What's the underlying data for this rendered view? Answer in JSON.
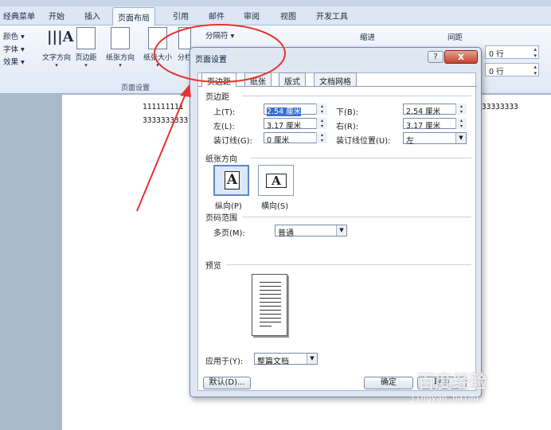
{
  "menu_tabs": [
    "经典菜单",
    "开始",
    "插入",
    "页面布局",
    "引用",
    "邮件",
    "审阅",
    "视图",
    "开发工具"
  ],
  "ribbon": {
    "theme_items": [
      "颜色 ▾",
      "字体 ▾",
      "效果 ▾"
    ],
    "buttons": [
      "文字方向",
      "页边距",
      "纸张方向",
      "纸张大小",
      "分栏"
    ],
    "break_label": "分隔符 ▾",
    "page_setup_group": "页面设置",
    "indent_label": "缩进",
    "spacing_label": "间距",
    "spacing_before": "0 行",
    "spacing_after": "0 行"
  },
  "document": {
    "line1": "111111111",
    "line2": "3333333333",
    "line3": "33333333"
  },
  "dialog": {
    "title": "页面设置",
    "help": "?",
    "close": "x",
    "tabs": [
      "页边距",
      "纸张",
      "版式",
      "文档网格"
    ],
    "margins_section": "页边距",
    "top_label": "上(T):",
    "top_value": "2.54 厘米",
    "bottom_label": "下(B):",
    "bottom_value": "2.54 厘米",
    "left_label": "左(L):",
    "left_value": "3.17 厘米",
    "right_label": "右(R):",
    "right_value": "3.17 厘米",
    "gutter_label": "装订线(G):",
    "gutter_value": "0 厘米",
    "gutter_pos_label": "装订线位置(U):",
    "gutter_pos_value": "左",
    "orientation_section": "纸张方向",
    "portrait": "纵向(P)",
    "landscape": "横向(S)",
    "pages_section": "页码范围",
    "multi_label": "多页(M):",
    "multi_value": "普通",
    "preview_section": "预览",
    "apply_label": "应用于(Y):",
    "apply_value": "整篇文档",
    "default_btn": "默认(D)...",
    "ok_btn": "确定",
    "cancel_btn": "取消"
  },
  "watermark": {
    "main": "百度经验",
    "sub": "jingyan.baidu.com"
  },
  "colors": {
    "accent": "#5d89c5",
    "annotation": "#e8322c",
    "close": "#c4432c"
  }
}
